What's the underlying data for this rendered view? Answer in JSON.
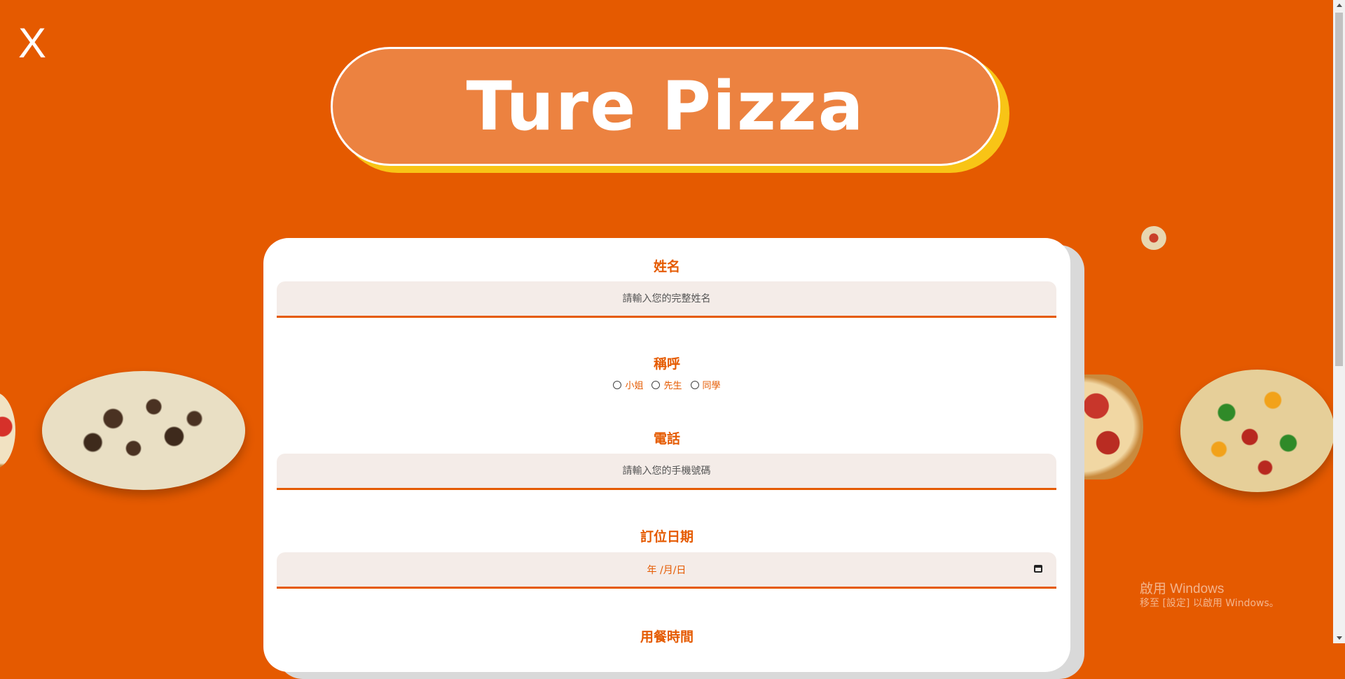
{
  "close_label": "X",
  "brand": {
    "title": "Ture Pizza"
  },
  "form": {
    "name": {
      "label": "姓名",
      "placeholder": "請輸入您的完整姓名"
    },
    "salutation": {
      "label": "稱呼",
      "options": [
        "小姐",
        "先生",
        "同學"
      ]
    },
    "phone": {
      "label": "電話",
      "placeholder": "請輸入您的手機號碼"
    },
    "date": {
      "label": "訂位日期",
      "value": "年 /月/日"
    },
    "time": {
      "label": "用餐時間"
    }
  },
  "watermark": {
    "title": "啟用 Windows",
    "subtitle": "移至 [設定] 以啟用 Windows。"
  },
  "colors": {
    "background": "#E55A00",
    "pill": "#EC8240",
    "pill_shadow": "#F8C416",
    "input_bg": "#F4ECE8"
  }
}
